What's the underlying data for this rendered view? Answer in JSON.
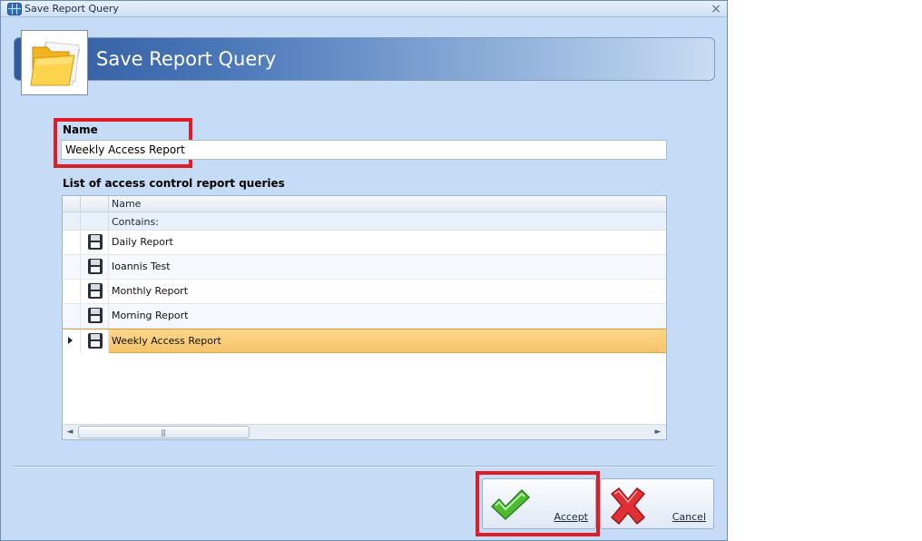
{
  "window": {
    "title": "Save Report Query",
    "close_label": "×"
  },
  "header": {
    "title": "Save Report Query",
    "icon": "folder-icon"
  },
  "name_field": {
    "label": "Name",
    "value": "Weekly Access Report"
  },
  "list": {
    "label": "List of access control report queries",
    "column_header": "Name",
    "filter_text": "Contains:",
    "rows": [
      {
        "label": "Daily Report",
        "icon": "save-disk-icon",
        "selected": false
      },
      {
        "label": "Ioannis Test",
        "icon": "save-disk-icon",
        "selected": false
      },
      {
        "label": "Monthly Report",
        "icon": "save-disk-icon",
        "selected": false
      },
      {
        "label": "Morning Report",
        "icon": "save-disk-icon",
        "selected": false
      },
      {
        "label": "Weekly Access Report",
        "icon": "save-disk-icon",
        "selected": true
      }
    ],
    "scrollbar": {
      "left_arrow": "◄",
      "right_arrow": "►",
      "grip": "|||"
    }
  },
  "buttons": {
    "accept_label": "Accept",
    "cancel_label": "Cancel"
  },
  "colors": {
    "highlight": "#e01c24",
    "selected_row": "#f6c46b",
    "accept_icon": "#3fae2a",
    "cancel_icon": "#d8232a"
  }
}
